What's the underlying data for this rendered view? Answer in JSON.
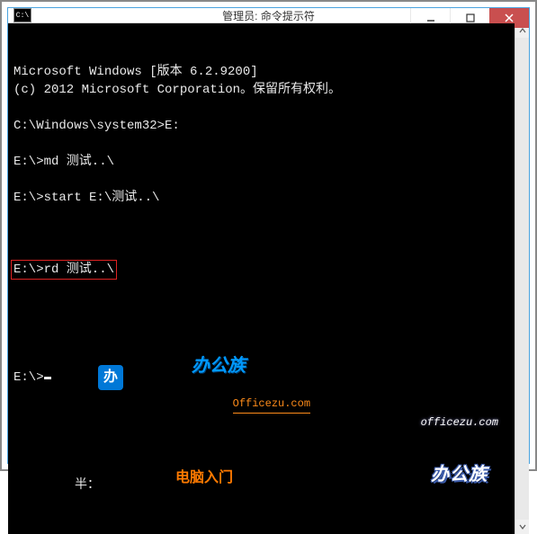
{
  "window": {
    "icon_text": "C:\\",
    "title": "管理员: 命令提示符",
    "controls": {
      "min_label": "minimize",
      "max_label": "maximize",
      "close_label": "close"
    }
  },
  "terminal": {
    "lines": [
      "Microsoft Windows [版本 6.2.9200]",
      "(c) 2012 Microsoft Corporation。保留所有权利。",
      "",
      "C:\\Windows\\system32>E:",
      "",
      "E:\\>md 测试..\\",
      "",
      "E:\\>start E:\\测试..\\",
      ""
    ],
    "highlighted_line": "E:\\>rd 测试..\\",
    "after_highlight": [
      ""
    ],
    "final_prompt": "E:\\>"
  },
  "watermark_left": {
    "logo_char": "办",
    "main": "办公族",
    "url": "Officezu.com",
    "sub": "电脑入门",
    "half_label": "半："
  },
  "watermark_right": {
    "url": "officezu.com",
    "main": "办公族"
  }
}
